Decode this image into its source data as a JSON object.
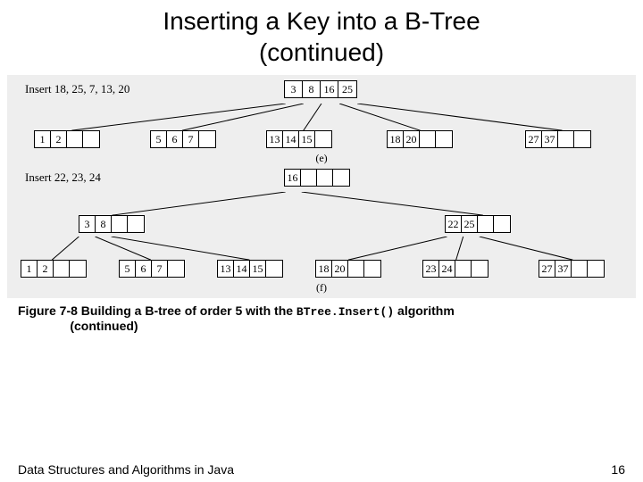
{
  "title_line1": "Inserting a Key into a B-Tree",
  "title_line2": "(continued)",
  "diagram_e": {
    "insert_label": "Insert 18, 25, 7, 13, 20",
    "root": [
      "3",
      "8",
      "16",
      "25"
    ],
    "leaves": [
      {
        "cells": [
          "1",
          "2",
          "",
          ""
        ]
      },
      {
        "cells": [
          "5",
          "6",
          "7",
          ""
        ]
      },
      {
        "cells": [
          "13",
          "14",
          "15",
          ""
        ]
      },
      {
        "cells": [
          "18",
          "20",
          "",
          ""
        ]
      },
      {
        "cells": [
          "27",
          "37",
          "",
          ""
        ]
      }
    ],
    "sublabel": "(e)"
  },
  "diagram_f": {
    "insert_label": "Insert 22, 23, 24",
    "root": [
      "16",
      "",
      "",
      ""
    ],
    "mids": [
      {
        "cells": [
          "3",
          "8",
          "",
          ""
        ]
      },
      {
        "cells": [
          "22",
          "25",
          "",
          ""
        ]
      }
    ],
    "leaves": [
      {
        "cells": [
          "1",
          "2",
          "",
          ""
        ]
      },
      {
        "cells": [
          "5",
          "6",
          "7",
          ""
        ]
      },
      {
        "cells": [
          "13",
          "14",
          "15",
          ""
        ]
      },
      {
        "cells": [
          "18",
          "20",
          "",
          ""
        ]
      },
      {
        "cells": [
          "23",
          "24",
          "",
          ""
        ]
      },
      {
        "cells": [
          "27",
          "37",
          "",
          ""
        ]
      }
    ],
    "sublabel": "(f)"
  },
  "caption_pre": "Figure 7-8 Building a B-tree of order 5 with the ",
  "caption_code": "BTree.Insert()",
  "caption_post": " algorithm",
  "caption_cont": "(continued)",
  "footer_left": "Data Structures and Algorithms in Java",
  "footer_right": "16"
}
